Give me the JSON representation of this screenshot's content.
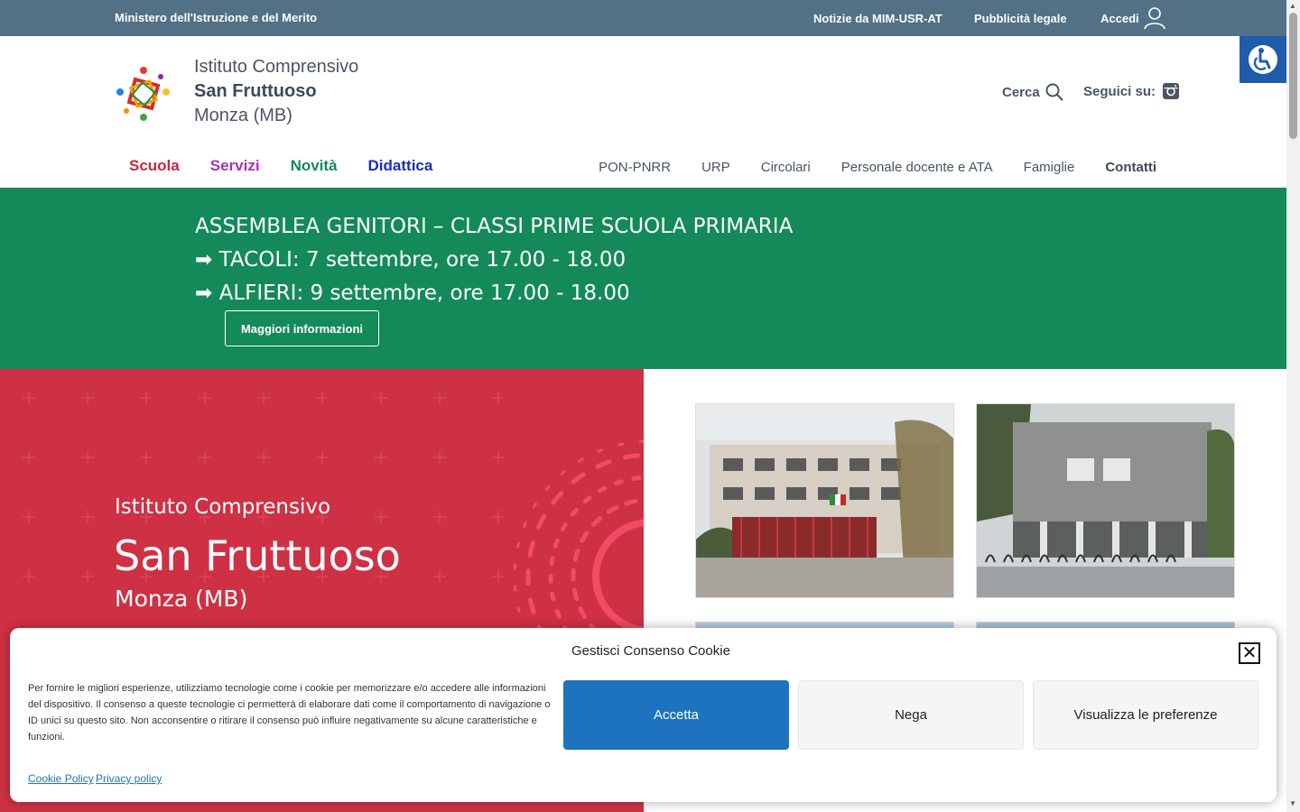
{
  "topbar": {
    "ministry": "Ministero dell'Istruzione e del Merito",
    "links": [
      "Notizie da MIM-USR-AT",
      "Pubblicità legale",
      "Accedi"
    ]
  },
  "header": {
    "brand_line1": "Istituto Comprensivo",
    "brand_line2": "San Fruttuoso",
    "brand_line3": "Monza (MB)",
    "search_label": "Cerca",
    "follow_label": "Seguici su:",
    "main_nav": [
      {
        "label": "Scuola",
        "color": "#c3283d"
      },
      {
        "label": "Servizi",
        "color": "#a532b5"
      },
      {
        "label": "Novità",
        "color": "#148a5a"
      },
      {
        "label": "Didattica",
        "color": "#1c2fb8"
      }
    ],
    "secondary_nav": [
      "PON-PNRR",
      "URP",
      "Circolari",
      "Personale docente e ATA",
      "Famiglie",
      "Contatti"
    ]
  },
  "banner": {
    "line1": "ASSEMBLEA GENITORI – CLASSI PRIME SCUOLA PRIMARIA",
    "line2": "➡ TACOLI: 7 settembre, ore 17.00 - 18.00",
    "line3": "➡ ALFIERI: 9 settembre, ore 17.00 - 18.00",
    "button": "Maggiori informazioni"
  },
  "hero": {
    "line1": "Istituto Comprensivo",
    "line2": "San Fruttuoso",
    "line3": "Monza (MB)"
  },
  "cookie": {
    "title": "Gestisci Consenso Cookie",
    "text": "Per fornire le migliori esperienze, utilizziamo tecnologie come i cookie per memorizzare e/o accedere alle informazioni del dispositivo. Il consenso a queste tecnologie ci permetterà di elaborare dati come il comportamento di navigazione o ID unici su questo sito. Non acconsentire o ritirare il consenso può influire negativamente su alcune caratteristiche e funzioni.",
    "accept": "Accetta",
    "deny": "Nega",
    "preferences": "Visualizza le preferenze",
    "cookie_policy": "Cookie Policy",
    "privacy_policy": "Privacy policy"
  },
  "colors": {
    "topbar": "#527187",
    "banner": "#148a5a",
    "hero": "#cf3144",
    "accent": "#1e73be"
  },
  "icons": [
    "user-icon",
    "search-icon",
    "instagram-icon",
    "accessibility-icon",
    "close-icon"
  ]
}
